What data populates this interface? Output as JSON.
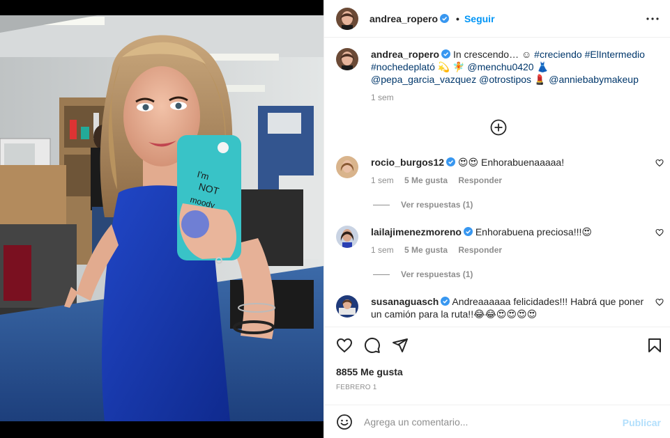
{
  "post": {
    "username": "andrea_ropero",
    "follow_label": "Seguir",
    "dot": "•"
  },
  "caption": {
    "username": "andrea_ropero",
    "text_a": "In crescendo… ☺ ",
    "tag1": "#creciendo",
    "tag2": "#ElIntermedio",
    "tag3": "#nochedeplató",
    "text_b": " 💫 🧚 ",
    "mention1": "@menchu0420",
    "text_c": " 👗",
    "mention2": "@pepa_garcia_vazquez",
    "mention3": "@otrostipos",
    "text_d": " 💄 ",
    "mention4": "@anniebabymakeup",
    "time": "1 sem"
  },
  "comments": [
    {
      "username": "rocio_burgos12",
      "text": "😍😍 Enhorabuenaaaaa!",
      "time": "1 sem",
      "likes": "5 Me gusta",
      "reply_label": "Responder",
      "view_replies": "Ver respuestas (1)"
    },
    {
      "username": "lailajimenezmoreno",
      "text": "Enhorabuena preciosa!!!😍",
      "time": "1 sem",
      "likes": "5 Me gusta",
      "reply_label": "Responder",
      "view_replies": "Ver respuestas (1)"
    },
    {
      "username": "susanaguasch",
      "text": "Andreaaaaaa felicidades!!! Habrá que poner un camión para la ruta!!😂😂😍😍😍😍"
    }
  ],
  "stats": {
    "likes": "8855 Me gusta",
    "date": "FEBRERO 1"
  },
  "composer": {
    "placeholder": "Agrega un comentario...",
    "publish_label": "Publicar"
  },
  "icons": [
    "heart-icon",
    "comment-icon",
    "share-icon",
    "bookmark-icon",
    "emoji-icon",
    "add-circle-icon",
    "more-icon",
    "verified-icon"
  ],
  "colors": {
    "link_blue": "#0095f6",
    "hashtag": "#00376b",
    "muted": "#8e8e8e",
    "publish_disabled": "#b2dffc",
    "verified": "#3897f0"
  }
}
